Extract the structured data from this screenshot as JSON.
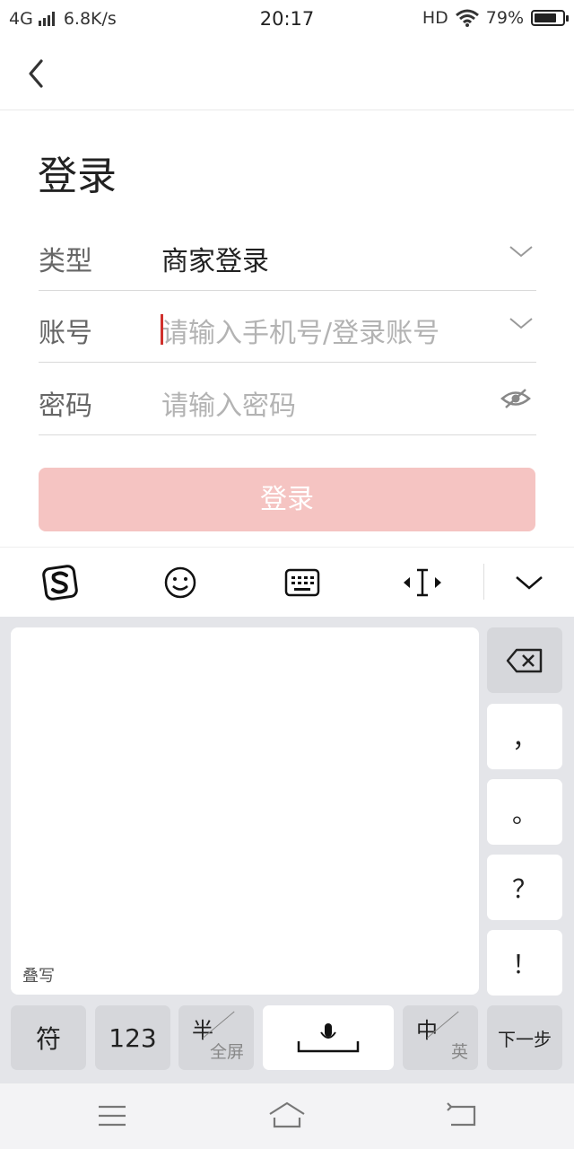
{
  "status_bar": {
    "network": "4G",
    "speed": "6.8K/s",
    "time": "20:17",
    "hd": "HD",
    "battery": "79%",
    "battery_level": 0.79
  },
  "page": {
    "title": "登录"
  },
  "form": {
    "type_label": "类型",
    "type_value": "商家登录",
    "account_label": "账号",
    "account_placeholder": "请输入手机号/登录账号",
    "password_label": "密码",
    "password_placeholder": "请输入密码",
    "submit_label": "登录"
  },
  "keyboard": {
    "handwriting_label": "叠写",
    "side_keys": [
      "，",
      "。",
      "？",
      "！"
    ],
    "bottom": {
      "symbols": "符",
      "numbers": "123",
      "half_top": "半",
      "half_bottom": "全屏",
      "lang_top": "中",
      "lang_bottom": "英",
      "next": "下一步"
    }
  },
  "colors": {
    "accent_disabled": "#f5c4c2",
    "caret": "#d0312d"
  }
}
